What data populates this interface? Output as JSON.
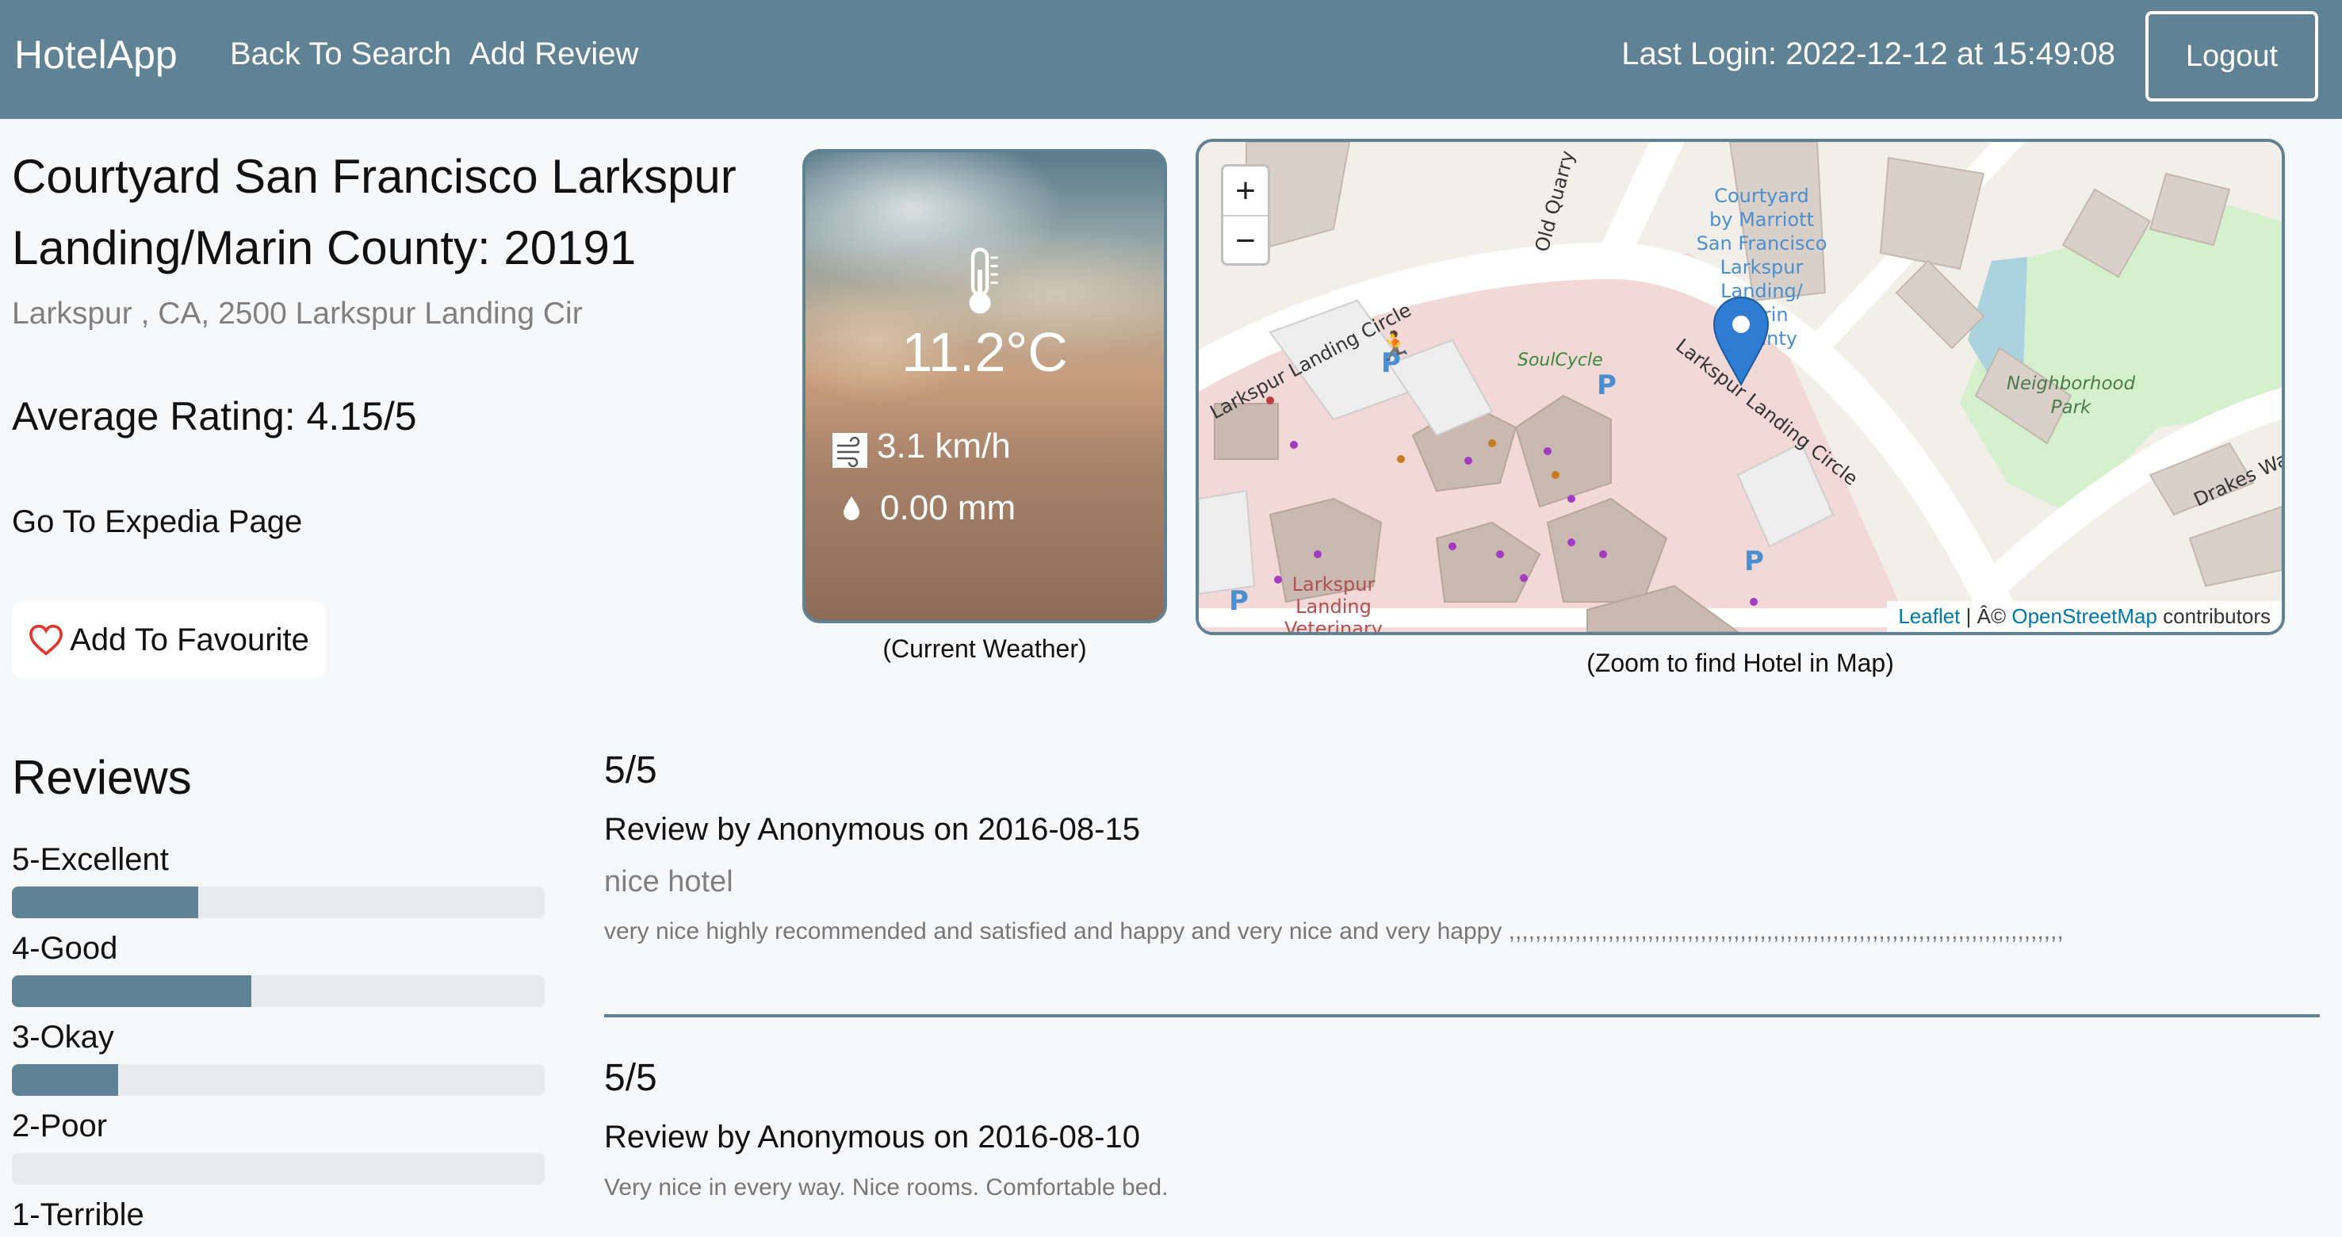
{
  "navbar": {
    "brand": "HotelApp",
    "back_to_search": "Back To Search",
    "add_review": "Add Review",
    "last_login": "Last Login: 2022-12-12 at 15:49:08",
    "logout": "Logout",
    "bg_color": "#5f8294"
  },
  "hotel": {
    "title": "Courtyard San Francisco Larkspur Landing/Marin County: 20191",
    "address": "Larkspur , CA, 2500 Larkspur Landing Cir",
    "average_rating": "Average Rating: 4.15/5",
    "expedia_link": "Go To Expedia Page",
    "favourite_button": "Add To Favourite",
    "favourite_icon": "heart-icon"
  },
  "weather": {
    "temperature": "11.2°C",
    "wind": "3.1 km/h",
    "precipitation": "0.00 mm",
    "caption": "(Current Weather)",
    "icons": [
      "thermometer-icon",
      "wind-icon",
      "raindrop-icon"
    ]
  },
  "map": {
    "zoom_in": "+",
    "zoom_out": "−",
    "attribution_leaflet": "Leaflet",
    "attribution_sep": " | Â© ",
    "attribution_osm": "OpenStreetMap",
    "attribution_tail": " contributors",
    "caption": "(Zoom to find Hotel in Map)",
    "labels": {
      "road_main": "Larkspur Landing Circle",
      "road_left": "Larkspur Landing Circle",
      "old_quarry": "Old Quarry",
      "hotel_line1": "Courtyard",
      "hotel_line2": "by Marriott",
      "hotel_line3": "San Francisco",
      "hotel_line4": "Larkspur",
      "hotel_line5": "Landing/",
      "hotel_line6": "Marin",
      "hotel_line7": "unty",
      "soulcycle": "SoulCycle",
      "park_line1": "Neighborhood",
      "park_line2": "Park",
      "drakes_way": "Drakes Way",
      "larkspur_landing_line1": "Larkspur",
      "larkspur_landing_line2": "Landing",
      "vet": "Veterinary"
    }
  },
  "reviews_summary": {
    "title": "Reviews",
    "ratings": [
      {
        "label": "5-Excellent",
        "fraction": 0.35
      },
      {
        "label": "4-Good",
        "fraction": 0.45
      },
      {
        "label": "3-Okay",
        "fraction": 0.2
      },
      {
        "label": "2-Poor",
        "fraction": 0.0
      },
      {
        "label": "1-Terrible",
        "fraction": 0.0
      }
    ]
  },
  "reviews": [
    {
      "score": "5/5",
      "by": "Review by Anonymous on 2016-08-15",
      "title": "nice hotel",
      "text": "very nice highly recommended and satisfied and happy and very nice and very happy ,,,,,,,,,,,,,,,,,,,,,,,,,,,,,,,,,,,,,,,,,,,,,,,,,,,,,,,,,,,,,,,,,,,,,,,,,,,,,,,,,,,,"
    },
    {
      "score": "5/5",
      "by": "Review by Anonymous on 2016-08-10",
      "text": "Very nice in every way. Nice rooms. Comfortable bed."
    }
  ]
}
